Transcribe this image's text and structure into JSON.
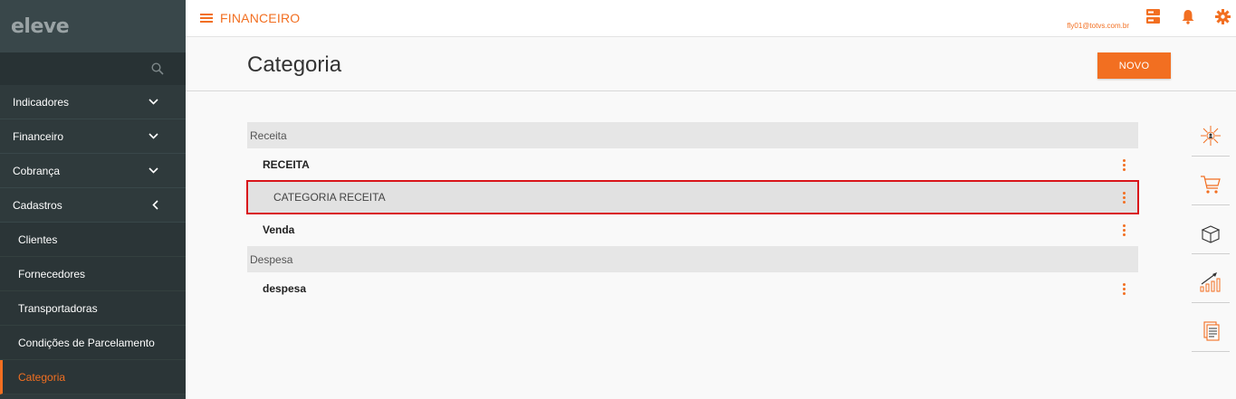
{
  "sidebar": {
    "logo": "eleve",
    "items": [
      {
        "label": "Indicadores"
      },
      {
        "label": "Financeiro"
      },
      {
        "label": "Cobrança"
      },
      {
        "label": "Cadastros"
      }
    ],
    "subitems": [
      {
        "label": "Clientes"
      },
      {
        "label": "Fornecedores"
      },
      {
        "label": "Transportadoras"
      },
      {
        "label": "Condições de Parcelamento"
      },
      {
        "label": "Categoria"
      }
    ]
  },
  "topbar": {
    "module": "FINANCEIRO",
    "user_email": "fly01@totvs.com.br"
  },
  "header": {
    "title": "Categoria",
    "new_button": "NOVO"
  },
  "list": {
    "groups": [
      {
        "name": "Receita",
        "rows": [
          {
            "label": "RECEITA"
          },
          {
            "label": "CATEGORIA RECEITA"
          },
          {
            "label": "Venda"
          }
        ]
      },
      {
        "name": "Despesa",
        "rows": [
          {
            "label": "despesa"
          }
        ]
      }
    ]
  },
  "colors": {
    "accent": "#f26f21",
    "sidebar_bg": "#2f3a3c",
    "highlight_border": "#d9151b"
  },
  "icons": {
    "top": [
      "server-icon",
      "bell-icon",
      "gear-icon"
    ],
    "shortcuts": [
      "network-icon",
      "cart-icon",
      "box-icon",
      "chart-growth-icon",
      "document-icon"
    ]
  }
}
